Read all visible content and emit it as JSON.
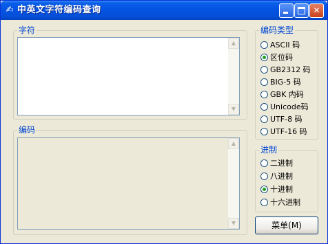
{
  "window": {
    "title": "中英文字符编码查询",
    "app_icon": "magic-wand-icon"
  },
  "titlebar_buttons": {
    "minimize": "minimize-icon",
    "maximize": "maximize-icon",
    "close_glyph": "✕"
  },
  "chars_group": {
    "label": "字符",
    "input_value": ""
  },
  "encoding_group": {
    "label": "编码",
    "output_value": ""
  },
  "encoding_type": {
    "label": "编码类型",
    "options": [
      "ASCII 码",
      "区位码",
      "GB2312 码",
      "BIG-5 码",
      "GBK 内码",
      "Unicode码",
      "UTF-8 码",
      "UTF-16 码"
    ],
    "selected": "区位码"
  },
  "radix": {
    "label": "进制",
    "options": [
      "二进制",
      "八进制",
      "十进制",
      "十六进制"
    ],
    "selected": "十进制"
  },
  "menu_button": {
    "label": "菜单(M)"
  },
  "colors": {
    "titlebar": "#0553E3",
    "group_label": "#0046D5",
    "radio_selected": "#21A121",
    "window_bg": "#ECE9D8"
  }
}
